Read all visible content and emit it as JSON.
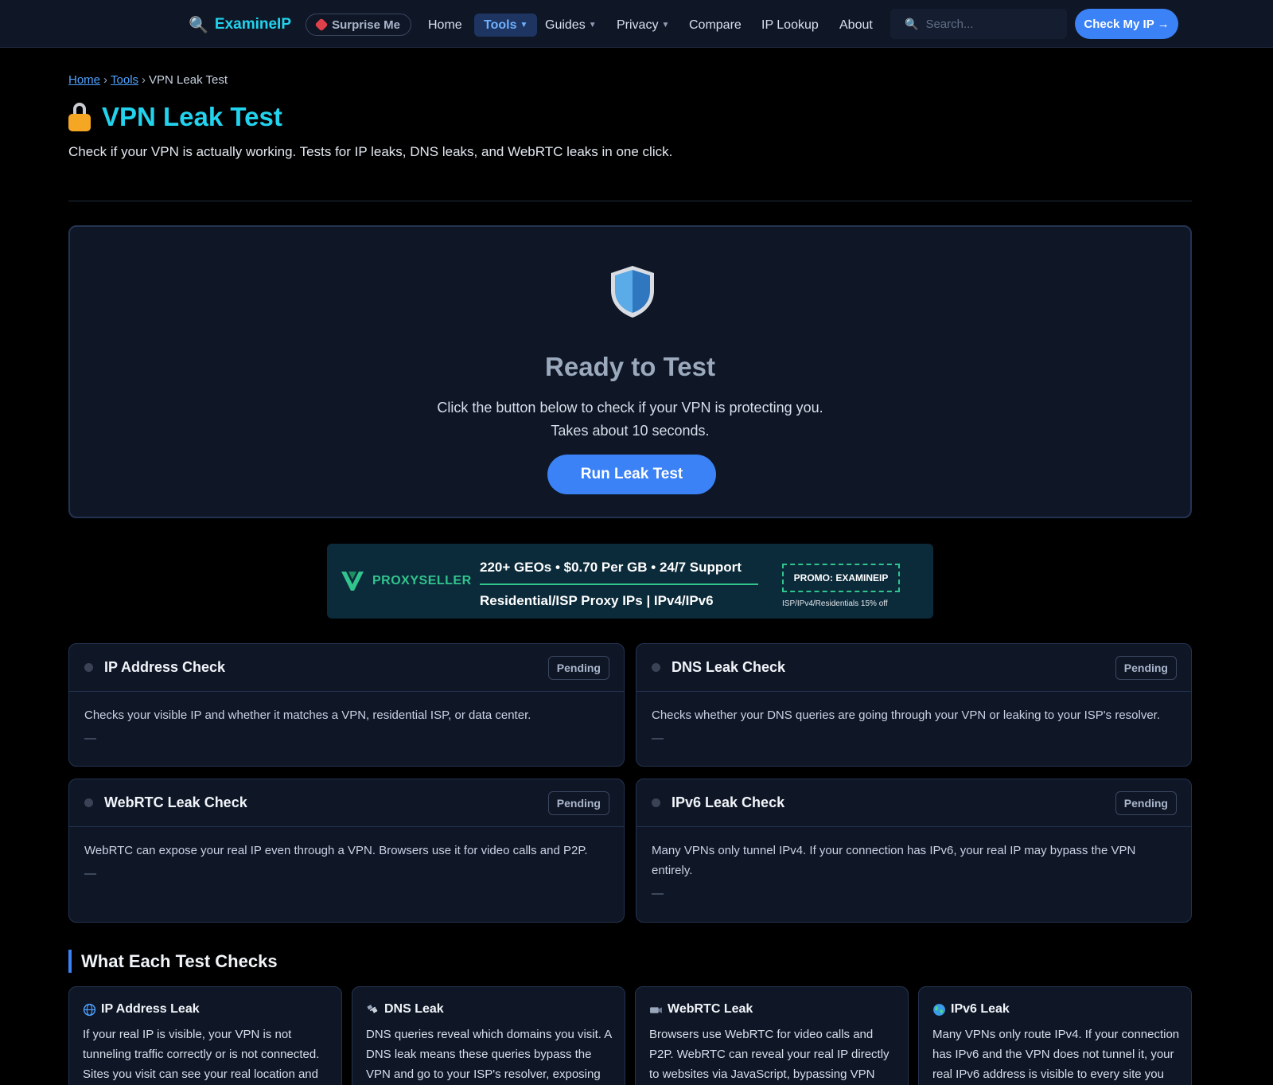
{
  "nav": {
    "brand": "ExamineIP",
    "surprise_label": "Surprise Me",
    "links": [
      {
        "label": "Home"
      },
      {
        "label": "Tools"
      },
      {
        "label": "Guides"
      },
      {
        "label": "Privacy"
      },
      {
        "label": "Compare"
      },
      {
        "label": "IP Lookup"
      },
      {
        "label": "About"
      }
    ],
    "search_placeholder": "Search...",
    "cta_label": "Check My IP →"
  },
  "breadcrumb": {
    "home": "Home",
    "tools": "Tools",
    "current": "VPN Leak Test",
    "separator": "›"
  },
  "page": {
    "title": "VPN Leak Test",
    "subtitle": "Check if your VPN is actually working. Tests for IP leaks, DNS leaks, and WebRTC leaks in one click."
  },
  "hero": {
    "title": "Ready to Test",
    "desc_line1": "Click the button below to check if your VPN is protecting you.",
    "desc_line2": "Takes about 10 seconds.",
    "button": "Run Leak Test"
  },
  "ad": {
    "brand": "PROXYSELLER",
    "line1": "220+ GEOs • $0.70 Per GB • 24/7 Support",
    "line2": "Residential/ISP Proxy IPs | IPv4/IPv6",
    "promo": "PROMO: EXAMINEIP",
    "small": "ISP/IPv4/Residentials 15% off"
  },
  "checks": [
    {
      "title": "IP Address Check",
      "status": "Pending",
      "desc": "Checks your visible IP and whether it matches a VPN, residential ISP, or data center.",
      "value": "—"
    },
    {
      "title": "DNS Leak Check",
      "status": "Pending",
      "desc": "Checks whether your DNS queries are going through your VPN or leaking to your ISP's resolver.",
      "value": "—"
    },
    {
      "title": "WebRTC Leak Check",
      "status": "Pending",
      "desc": "WebRTC can expose your real IP even through a VPN. Browsers use it for video calls and P2P.",
      "value": "—"
    },
    {
      "title": "IPv6 Leak Check",
      "status": "Pending",
      "desc": "Many VPNs only tunnel IPv4. If your connection has IPv6, your real IP may bypass the VPN entirely.",
      "value": "—"
    }
  ],
  "section": {
    "title": "What Each Test Checks"
  },
  "info": [
    {
      "title": "IP Address Leak",
      "icon": "globe-icon",
      "text": "If your real IP is visible, your VPN is not tunneling traffic correctly or is not connected. Sites you visit can see your real location and"
    },
    {
      "title": "DNS Leak",
      "icon": "satellite-icon",
      "text": "DNS queries reveal which domains you visit. A DNS leak means these queries bypass the VPN and go to your ISP's resolver, exposing"
    },
    {
      "title": "WebRTC Leak",
      "icon": "video-camera-icon",
      "text": "Browsers use WebRTC for video calls and P2P. WebRTC can reveal your real IP directly to websites via JavaScript, bypassing VPN"
    },
    {
      "title": "IPv6 Leak",
      "icon": "earth-icon",
      "text": "Many VPNs only route IPv4. If your connection has IPv6 and the VPN does not tunnel it, your real IPv6 address is visible to every site you"
    }
  ],
  "colors": {
    "accent": "#3b82f6",
    "brand": "#22d3ee",
    "background": "#000000",
    "card": "#0f1626"
  }
}
